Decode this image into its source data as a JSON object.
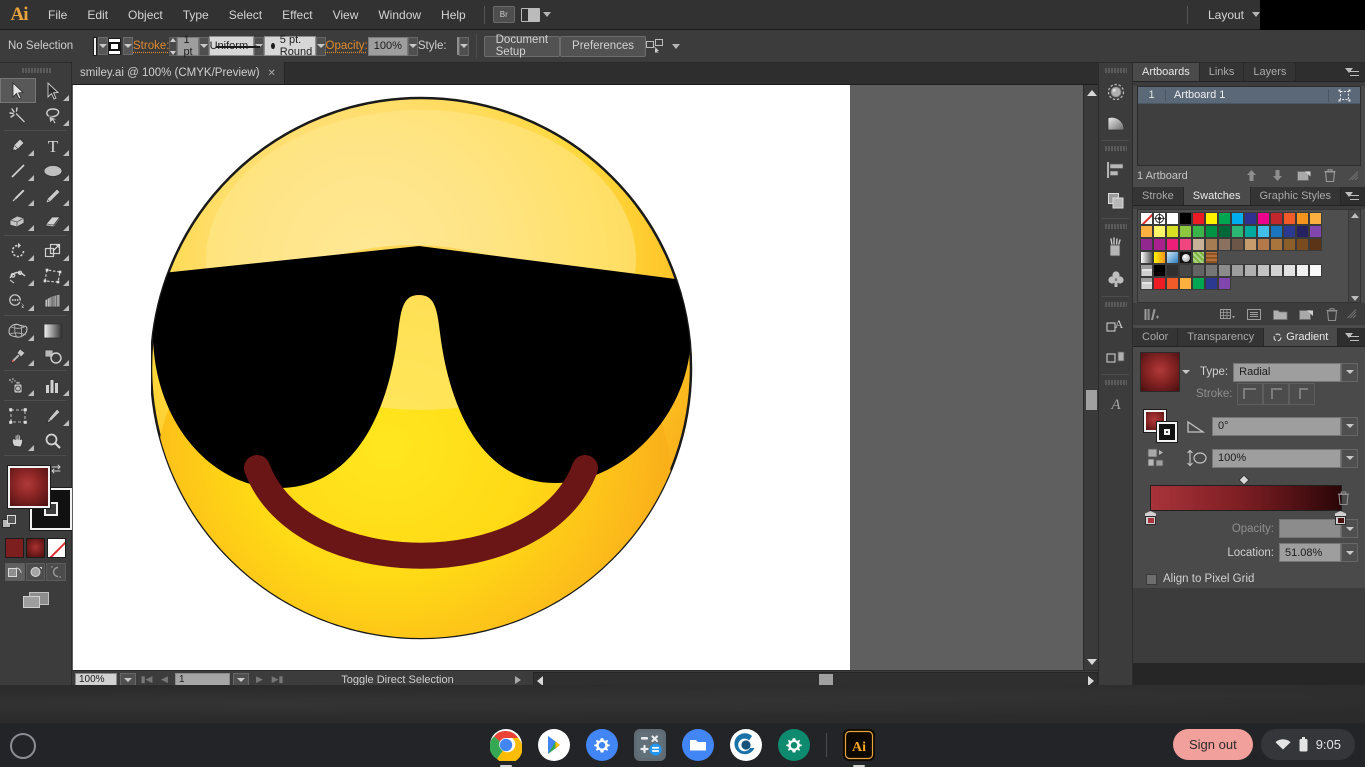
{
  "menubar": {
    "logo": "Ai",
    "items": [
      "File",
      "Edit",
      "Object",
      "Type",
      "Select",
      "Effect",
      "View",
      "Window",
      "Help"
    ],
    "bridge_label": "Br",
    "layout_label": "Layout"
  },
  "controlbar": {
    "selection_status": "No Selection",
    "fill_label": "fill-swatch",
    "stroke_label": "Stroke:",
    "stroke_weight": "1 pt",
    "profile_label": "Uniform",
    "brush_label": "5 pt. Round",
    "opacity_label": "Opacity:",
    "opacity_value": "100%",
    "style_label": "Style:",
    "document_setup": "Document Setup",
    "preferences": "Preferences"
  },
  "toolbar": {
    "tools": [
      {
        "name": "selection-tool",
        "selected": true
      },
      {
        "name": "direct-selection-tool",
        "selected": false
      },
      {
        "name": "magic-wand-tool",
        "selected": false
      },
      {
        "name": "lasso-tool",
        "selected": false
      },
      {
        "name": "pen-tool",
        "selected": false
      },
      {
        "name": "type-tool",
        "selected": false
      },
      {
        "name": "line-segment-tool",
        "selected": false
      },
      {
        "name": "ellipse-tool",
        "selected": false
      },
      {
        "name": "paintbrush-tool",
        "selected": false
      },
      {
        "name": "pencil-tool",
        "selected": false
      },
      {
        "name": "blob-brush-tool",
        "selected": false
      },
      {
        "name": "eraser-tool",
        "selected": false
      },
      {
        "name": "rotate-tool",
        "selected": false
      },
      {
        "name": "scale-tool",
        "selected": false
      },
      {
        "name": "width-tool",
        "selected": false
      },
      {
        "name": "free-transform-tool",
        "selected": false
      },
      {
        "name": "shape-builder-tool",
        "selected": false
      },
      {
        "name": "perspective-grid-tool",
        "selected": false
      },
      {
        "name": "mesh-tool",
        "selected": false
      },
      {
        "name": "gradient-tool",
        "selected": false
      },
      {
        "name": "eyedropper-tool",
        "selected": false
      },
      {
        "name": "blend-tool",
        "selected": false
      },
      {
        "name": "symbol-sprayer-tool",
        "selected": false
      },
      {
        "name": "column-graph-tool",
        "selected": false
      },
      {
        "name": "artboard-tool",
        "selected": false
      },
      {
        "name": "slice-tool",
        "selected": false
      },
      {
        "name": "hand-tool",
        "selected": false
      },
      {
        "name": "zoom-tool",
        "selected": false
      }
    ],
    "fill_color": "#8d2626",
    "stroke_color": "#111111",
    "draw_modes": [
      "draw-normal",
      "draw-behind",
      "draw-inside"
    ],
    "color_modes": [
      "color-flat",
      "color-gradient",
      "color-none"
    ]
  },
  "document": {
    "tab_title": "smiley.ai @ 100% (CMYK/Preview)",
    "tab_close": "✕"
  },
  "artwork": {
    "name": "smiley-face-with-sunglasses",
    "face_color_light": "#ffe07a",
    "face_color_mid": "#ffdd00",
    "face_color_edge": "#f8a01c",
    "glasses_color": "#000000",
    "mouth_color": "#6b1616"
  },
  "statusbar": {
    "zoom": "100%",
    "page": "1",
    "status_text": "Toggle Direct Selection"
  },
  "icondock": {
    "icons": [
      "brushes-libraries-icon",
      "gradient-mesh-icon",
      "align-icon",
      "pathfinder-icon",
      "brushes-icon",
      "symbols-icon",
      "appearance-icon",
      "graphic-styles-icon",
      "character-icon"
    ]
  },
  "panels": {
    "top_group": {
      "tabs": [
        "Artboards",
        "Links",
        "Layers"
      ],
      "active": "Artboards",
      "artboards": [
        {
          "index": "1",
          "name": "Artboard 1"
        }
      ],
      "footer_count": "1 Artboard",
      "footer_buttons": [
        "move-up-button",
        "move-down-button",
        "new-artboard-button",
        "delete-artboard-button"
      ]
    },
    "swatches_group": {
      "tabs": [
        "Stroke",
        "Swatches",
        "Graphic Styles"
      ],
      "active": "Swatches",
      "footer_buttons": [
        "swatch-libraries-button",
        "show-swatch-kinds-button",
        "swatch-options-button",
        "new-color-group-button",
        "new-swatch-button",
        "delete-swatch-button"
      ],
      "rows": [
        [
          "none",
          "registration",
          "#ffffff",
          "#000000",
          "#ed1c24",
          "#fff200",
          "#00a651",
          "#00aeef",
          "#2e3192",
          "#ec008c",
          "#c1272d",
          "#f15a29",
          "#f7941e",
          "#fbb040"
        ],
        [
          "#fbb040",
          "#fff568",
          "#d7df23",
          "#8dc63f",
          "#39b54a",
          "#009245",
          "#006838",
          "#2bb673",
          "#00a99d",
          "#41bfe8",
          "#1b75bc",
          "#2b3990",
          "#262262",
          "#8246af"
        ],
        [
          "#92278f",
          "#a9218e",
          "#ed1e79",
          "#f0457e",
          "#c7b299",
          "#a67c52",
          "#8a7160",
          "#6b5647",
          "#c69c6d",
          "#b3794a",
          "#a9753c",
          "#8c5e2a",
          "#7a4b1e",
          "#5b3418"
        ],
        [
          "grad-gray",
          "grad-yellow",
          "grad-blue",
          "pattern-sphere",
          "pattern-leaves",
          "pattern-brick"
        ],
        [
          "group-folder",
          "#000000",
          "#2f2f2f",
          "#474747",
          "#636363",
          "#767676",
          "#8c8c8c",
          "#9e9e9e",
          "#b0b0b0",
          "#c2c2c2",
          "#d2d2d2",
          "#e2e2e2",
          "#f0f0f0",
          "#fafafa"
        ],
        [
          "group-folder",
          "#ed1c24",
          "#f15a29",
          "#fbb040",
          "#00a651",
          "#2b3990",
          "#8246af"
        ]
      ]
    },
    "gradient_group": {
      "tabs": [
        "Color",
        "Transparency",
        "Gradient"
      ],
      "active": "Gradient",
      "type_label": "Type:",
      "type_value": "Radial",
      "stroke_label": "Stroke:",
      "angle_value": "0°",
      "aspect_value": "100%",
      "opacity_label": "Opacity:",
      "opacity_value": "",
      "location_label": "Location:",
      "location_value": "51.08%",
      "align_pixel_grid": "Align to Pixel Grid",
      "gradient_start": "#a8333a",
      "gradient_end": "#2a0607",
      "stop_left_color": "#a8333a",
      "stop_right_color": "#4a0f0f"
    }
  },
  "shelf": {
    "apps": [
      {
        "name": "chrome-icon",
        "running": true
      },
      {
        "name": "play-store-icon",
        "running": false
      },
      {
        "name": "settings-blue-icon",
        "running": false
      },
      {
        "name": "calculator-icon",
        "running": false
      },
      {
        "name": "files-icon",
        "running": false
      },
      {
        "name": "browser-teal-icon",
        "running": false
      },
      {
        "name": "settings-green-icon",
        "running": false
      },
      {
        "name": "illustrator-icon",
        "running": true
      }
    ],
    "sign_out": "Sign out",
    "clock": "9:05"
  }
}
